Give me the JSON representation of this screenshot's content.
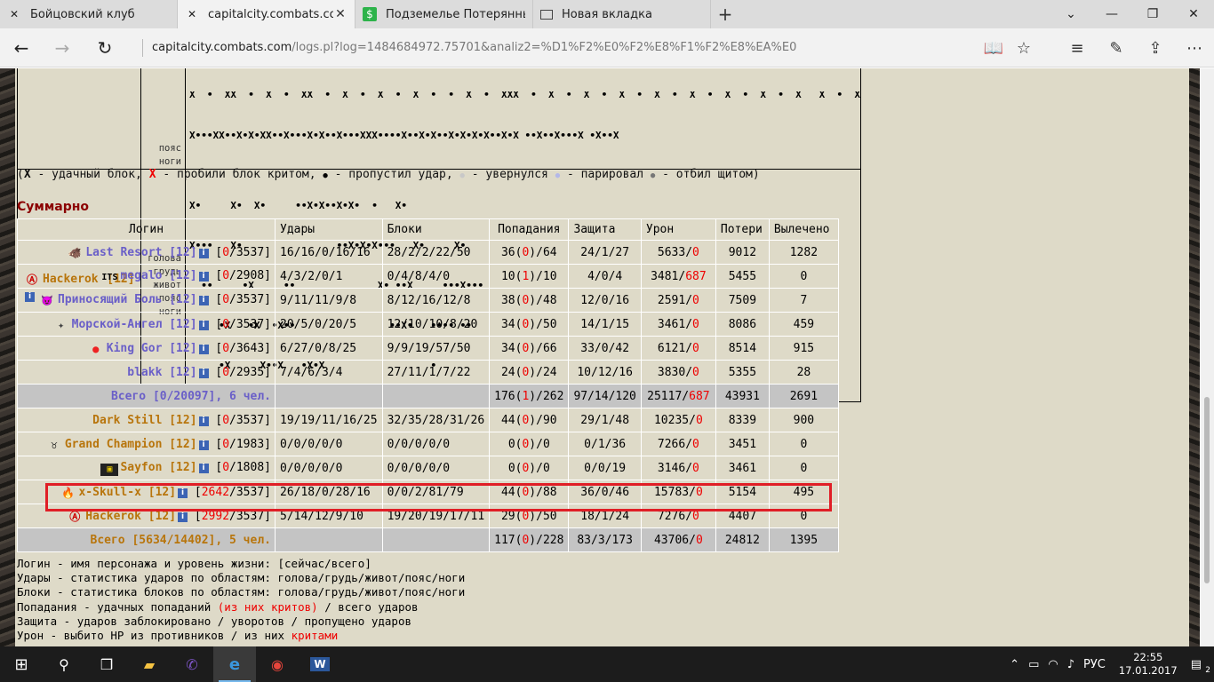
{
  "tabs": [
    {
      "title": "Бойцовский клуб",
      "icon": "combats-icon",
      "active": false
    },
    {
      "title": "capitalcity.combats.com",
      "icon": "combats-icon",
      "active": true
    },
    {
      "title": "Подземелье Потерянных",
      "icon": "dollar-icon",
      "active": false
    },
    {
      "title": "Новая вкладка",
      "icon": "newtab-icon",
      "active": false
    }
  ],
  "address": {
    "url_domain": "capitalcity.combats.com",
    "url_path": "/logs.pl?log=1484684972.75701&analiz2=%D1%F2%E0%F2%E8%F1%F2%E8%EA%E0"
  },
  "battle_table": {
    "zones": [
      "голова",
      "грудь",
      "живот",
      "пояс",
      "ноги"
    ],
    "top_row": {
      "marks": [
        "X•••XX••X•X•XX••X•••X•X••X•••XXX••••X••X•X••X•X•X•X••X•X ••X••X•••X •X••X"
      ],
      "zones_shown": [
        "пояс",
        "ноги"
      ]
    },
    "player": {
      "name": "Hackerok",
      "level": "[12]",
      "clan_icon": "anarchy-icon"
    },
    "marks": [
      "X•     X•  X•     ••X•X••X•X•  •   X•",
      "X•••   X•                ••X•X•X•••   X•     X•",
      "  ••     •X     ••              X• ••X     •••X•••",
      "     •X   •X  •X••                ••X•   •••• ••",
      "     •X     X••X   •X•X                  •"
    ]
  },
  "legend": {
    "x1": "X",
    "t1": " - удачный блок, ",
    "x2": "X",
    "t2": " - пробили блок критом, ",
    "d1": "●",
    "t3": " - пропустил удар, ",
    "d2": "●",
    "t4": " - увернулся ",
    "d3": "●",
    "t5": " - парировал ",
    "d4": "●",
    "t6": " - отбил щитом)"
  },
  "summary_title": "Суммарно",
  "summary": {
    "headers": [
      "Логин",
      "Удары",
      "Блоки",
      "Попадания",
      "Защита",
      "Урон",
      "Потери",
      "Вылечено"
    ],
    "team1": [
      {
        "name": "Last Resort",
        "level": "[12]",
        "hp_now": "0",
        "hp_max": "/3537]",
        "icon": "tank-icon",
        "hits": "16/16/0/16/16",
        "blocks": "28/2/2/22/50",
        "pop_a": "36(",
        "pop_c": "0",
        "pop_b": ")/64",
        "def": "24/1/27",
        "dmg": "5633/",
        "dmg_c": "0",
        "loss": "9012",
        "heal": "1282"
      },
      {
        "name": "megalo",
        "level": "[12]",
        "hp_now": "0",
        "hp_max": "/2908]",
        "icon": "its-icon",
        "hits": "4/3/2/0/1",
        "blocks": "0/4/8/4/0",
        "pop_a": "10(",
        "pop_c": "1",
        "pop_b": ")/10",
        "def": "4/0/4",
        "dmg": "3481/",
        "dmg_c": "687",
        "loss": "5455",
        "heal": "0"
      },
      {
        "name": "Приносящий Боль",
        "level": "[12]",
        "hp_now": "0",
        "hp_max": "/3537]",
        "icon": "demon-icon",
        "hits": "9/11/11/9/8",
        "blocks": "8/12/16/12/8",
        "pop_a": "38(",
        "pop_c": "0",
        "pop_b": ")/48",
        "def": "12/0/16",
        "dmg": "2591/",
        "dmg_c": "0",
        "loss": "7509",
        "heal": "7"
      },
      {
        "name": "Морской-Ангел",
        "level": "[12]",
        "hp_now": "0",
        "hp_max": "/3537]",
        "icon": "angel-icon",
        "hits": "20/5/0/20/5",
        "blocks": "12/10/10/8/20",
        "pop_a": "34(",
        "pop_c": "0",
        "pop_b": ")/50",
        "def": "14/1/15",
        "dmg": "3461/",
        "dmg_c": "0",
        "loss": "8086",
        "heal": "459"
      },
      {
        "name": "King Gor",
        "level": "[12]",
        "hp_now": "0",
        "hp_max": "/3643]",
        "icon": "red-ball-icon",
        "hits": "6/27/0/8/25",
        "blocks": "9/9/19/57/50",
        "pop_a": "34(",
        "pop_c": "0",
        "pop_b": ")/66",
        "def": "33/0/42",
        "dmg": "6121/",
        "dmg_c": "0",
        "loss": "8514",
        "heal": "915"
      },
      {
        "name": "blakk",
        "level": "[12]",
        "hp_now": "0",
        "hp_max": "/2935]",
        "icon": "",
        "hits": "7/4/6/3/4",
        "blocks": "27/11/1/7/22",
        "pop_a": "24(",
        "pop_c": "0",
        "pop_b": ")/24",
        "def": "10/12/16",
        "dmg": "3830/",
        "dmg_c": "0",
        "loss": "5355",
        "heal": "28"
      }
    ],
    "team1_total": {
      "label": "Всего [0/20097], 6 чел.",
      "pop_a": "176(",
      "pop_c": "1",
      "pop_b": ")/262",
      "def": "97/14/120",
      "dmg": "25117/",
      "dmg_c": "687",
      "loss": "43931",
      "heal": "2691"
    },
    "team2": [
      {
        "name": "Dark Still",
        "level": "[12]",
        "hp_now": "0",
        "hp_max": "/3537]",
        "icon": "",
        "hits": "19/19/11/16/25",
        "blocks": "32/35/28/31/26",
        "pop_a": "44(",
        "pop_c": "0",
        "pop_b": ")/90",
        "def": "29/1/48",
        "dmg": "10235/",
        "dmg_c": "0",
        "loss": "8339",
        "heal": "900"
      },
      {
        "name": "Grand Champion",
        "level": "[12]",
        "hp_now": "0",
        "hp_max": "/1983]",
        "icon": "bull-icon",
        "hits": "0/0/0/0/0",
        "blocks": "0/0/0/0/0",
        "pop_a": "0(",
        "pop_c": "0",
        "pop_b": ")/0",
        "def": "0/1/36",
        "dmg": "7266/",
        "dmg_c": "0",
        "loss": "3451",
        "heal": "0"
      },
      {
        "name": "Sayfon",
        "level": "[12]",
        "hp_now": "0",
        "hp_max": "/1808]",
        "icon": "ferrari-icon",
        "hits": "0/0/0/0/0",
        "blocks": "0/0/0/0/0",
        "pop_a": "0(",
        "pop_c": "0",
        "pop_b": ")/0",
        "def": "0/0/19",
        "dmg": "3146/",
        "dmg_c": "0",
        "loss": "3461",
        "heal": "0"
      },
      {
        "name": "x-Skull-x",
        "level": "[12]",
        "hp_now": "2642",
        "hp_max": "/3537]",
        "icon": "flame-icon",
        "hits": "26/18/0/28/16",
        "blocks": "0/0/2/81/79",
        "pop_a": "44(",
        "pop_c": "0",
        "pop_b": ")/88",
        "def": "36/0/46",
        "dmg": "15783/",
        "dmg_c": "0",
        "loss": "5154",
        "heal": "495"
      },
      {
        "name": "Hackerok",
        "level": "[12]",
        "hp_now": "2992",
        "hp_max": "/3537]",
        "icon": "anarchy-icon",
        "hits": "5/14/12/9/10",
        "blocks": "19/20/19/17/11",
        "pop_a": "29(",
        "pop_c": "0",
        "pop_b": ")/50",
        "def": "18/1/24",
        "dmg": "7276/",
        "dmg_c": "0",
        "loss": "4407",
        "heal": "0"
      }
    ],
    "team2_total": {
      "label": "Всего [5634/14402], 5 чел.",
      "pop_a": "117(",
      "pop_c": "0",
      "pop_b": ")/228",
      "def": "83/3/173",
      "dmg": "43706/",
      "dmg_c": "0",
      "loss": "24812",
      "heal": "1395"
    }
  },
  "notes": [
    {
      "a": "Логин - имя персонажа и уровень жизни: [сейчас/всего]",
      "r": "",
      "b": ""
    },
    {
      "a": "Удары - статистика ударов по областям: голова/грудь/живот/пояс/ноги",
      "r": "",
      "b": ""
    },
    {
      "a": "Блоки - статистика блоков по областям: голова/грудь/живот/пояс/ноги",
      "r": "",
      "b": ""
    },
    {
      "a": "Попадания - удачных попаданий ",
      "r": "(из них критов)",
      "b": " / всего ударов"
    },
    {
      "a": "Защита - ударов заблокировано / уворотов / пропущено ударов",
      "r": "",
      "b": ""
    },
    {
      "a": "Урон - выбито HP из противников / из них ",
      "r": "критами",
      "b": ""
    }
  ],
  "taskbar": {
    "lang": "РУС",
    "time": "22:55",
    "date": "17.01.2017",
    "notif_count": "2"
  },
  "colors": {
    "team1": "#6a5fc8",
    "team2": "#b8750c",
    "crit": "#e00000",
    "highlight": "#e01e26"
  }
}
